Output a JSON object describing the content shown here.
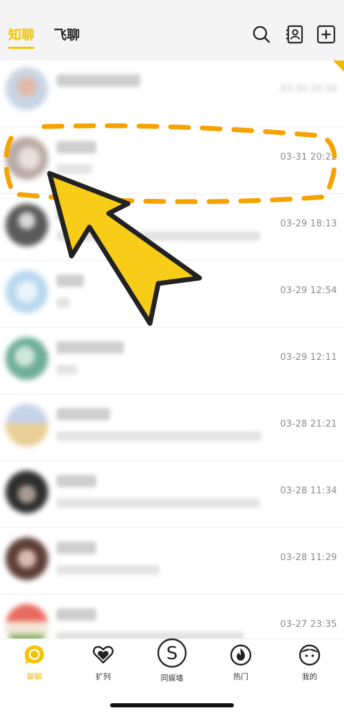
{
  "header": {
    "tabs": [
      {
        "label": "知聊",
        "active": true
      },
      {
        "label": "飞聊",
        "active": false
      }
    ],
    "icons": [
      "search-icon",
      "contacts-icon",
      "add-icon"
    ]
  },
  "conversations": [
    {
      "time": "03-30 20:34",
      "avatar_color": "#c9d4e3",
      "blurred_time": true
    },
    {
      "time": "03-31 20:22",
      "avatar_color": "#cfc6c2",
      "blurred_time": false
    },
    {
      "time": "03-29 18:13",
      "avatar_color": "#8a8a8a",
      "blurred_time": false
    },
    {
      "time": "03-29 12:54",
      "avatar_color": "#cfe3f2",
      "blurred_time": false
    },
    {
      "time": "03-29 12:11",
      "avatar_color": "#8fc4b4",
      "blurred_time": false
    },
    {
      "time": "03-28 21:21",
      "avatar_color": "#d9c8a0",
      "blurred_time": false
    },
    {
      "time": "03-28 11:34",
      "avatar_color": "#4d4d4d",
      "blurred_time": false
    },
    {
      "time": "03-28 11:29",
      "avatar_color": "#7b5a52",
      "blurred_time": false
    },
    {
      "time": "03-27 23:35",
      "avatar_color": "#e08a80",
      "blurred_time": false
    }
  ],
  "tabbar": [
    {
      "label": "聊聊",
      "icon": "chat-bubble-icon",
      "active": true
    },
    {
      "label": "扩列",
      "icon": "heart-icon",
      "active": false
    },
    {
      "label": "同娱墙",
      "icon": "s-circle-icon",
      "active": false
    },
    {
      "label": "热门",
      "icon": "fire-icon",
      "active": false
    },
    {
      "label": "我的",
      "icon": "profile-face-icon",
      "active": false
    }
  ],
  "colors": {
    "accent": "#f5c400",
    "arrow": "#f8cd1a",
    "dash": "#f5a300"
  }
}
